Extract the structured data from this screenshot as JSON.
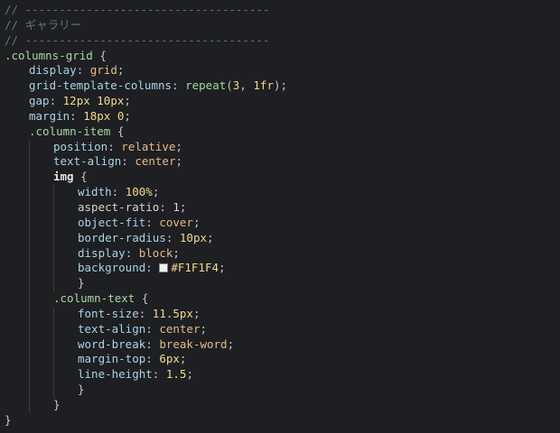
{
  "editor": {
    "colors": {
      "background": "#1e1f22",
      "comment": "#6b7079",
      "selector": "#a8d8a0",
      "property": "#a9d3e8",
      "value": "#e6b98a",
      "number": "#f2d98f",
      "swatch": "#F1F1F4"
    },
    "lines": [
      {
        "segments": [
          {
            "text": "// ------------------------------------",
            "kind": "comment"
          }
        ],
        "indent": 0
      },
      {
        "segments": [
          {
            "text": "// ギャラリー",
            "kind": "comment"
          }
        ],
        "indent": 0
      },
      {
        "segments": [
          {
            "text": "// ------------------------------------",
            "kind": "comment"
          }
        ],
        "indent": 0
      },
      {
        "segments": [
          {
            "text": ".columns-grid",
            "kind": "sel"
          },
          {
            "text": " {",
            "kind": "punc"
          }
        ],
        "indent": 0
      },
      {
        "segments": [
          {
            "text": "display",
            "kind": "prop"
          },
          {
            "text": ": ",
            "kind": "punc"
          },
          {
            "text": "grid",
            "kind": "val"
          },
          {
            "text": ";",
            "kind": "punc"
          }
        ],
        "indent": 1
      },
      {
        "segments": [
          {
            "text": "grid-template-columns",
            "kind": "prop"
          },
          {
            "text": ": ",
            "kind": "punc"
          },
          {
            "text": "repeat(",
            "kind": "sel"
          },
          {
            "text": "3",
            "kind": "num"
          },
          {
            "text": ", ",
            "kind": "punc"
          },
          {
            "text": "1fr",
            "kind": "num"
          },
          {
            "text": ");",
            "kind": "punc"
          }
        ],
        "indent": 1
      },
      {
        "segments": [
          {
            "text": "gap",
            "kind": "prop"
          },
          {
            "text": ": ",
            "kind": "punc"
          },
          {
            "text": "12px 10px",
            "kind": "num"
          },
          {
            "text": ";",
            "kind": "punc"
          }
        ],
        "indent": 1
      },
      {
        "segments": [
          {
            "text": "margin",
            "kind": "prop"
          },
          {
            "text": ": ",
            "kind": "punc"
          },
          {
            "text": "18px 0",
            "kind": "num"
          },
          {
            "text": ";",
            "kind": "punc"
          }
        ],
        "indent": 1
      },
      {
        "segments": [
          {
            "text": ".column-item",
            "kind": "sel"
          },
          {
            "text": " {",
            "kind": "punc"
          }
        ],
        "indent": 1
      },
      {
        "segments": [
          {
            "text": "position",
            "kind": "prop"
          },
          {
            "text": ": ",
            "kind": "punc"
          },
          {
            "text": "relative",
            "kind": "val"
          },
          {
            "text": ";",
            "kind": "punc"
          }
        ],
        "indent": 2
      },
      {
        "segments": [
          {
            "text": "text-align",
            "kind": "prop"
          },
          {
            "text": ": ",
            "kind": "punc"
          },
          {
            "text": "center",
            "kind": "val"
          },
          {
            "text": ";",
            "kind": "punc"
          }
        ],
        "indent": 2
      },
      {
        "segments": [
          {
            "text": "img",
            "kind": "tag"
          },
          {
            "text": " {",
            "kind": "punc"
          }
        ],
        "indent": 2
      },
      {
        "segments": [
          {
            "text": "width",
            "kind": "prop"
          },
          {
            "text": ": ",
            "kind": "punc"
          },
          {
            "text": "100%",
            "kind": "num"
          },
          {
            "text": ";",
            "kind": "punc"
          }
        ],
        "indent": 3
      },
      {
        "segments": [
          {
            "text": "aspect-ratio",
            "kind": "text"
          },
          {
            "text": ": ",
            "kind": "punc"
          },
          {
            "text": "1",
            "kind": "text"
          },
          {
            "text": ";",
            "kind": "punc"
          }
        ],
        "indent": 3
      },
      {
        "segments": [
          {
            "text": "object-fit",
            "kind": "prop"
          },
          {
            "text": ": ",
            "kind": "punc"
          },
          {
            "text": "cover",
            "kind": "val"
          },
          {
            "text": ";",
            "kind": "punc"
          }
        ],
        "indent": 3
      },
      {
        "segments": [
          {
            "text": "border-radius",
            "kind": "prop"
          },
          {
            "text": ": ",
            "kind": "punc"
          },
          {
            "text": "10px",
            "kind": "num"
          },
          {
            "text": ";",
            "kind": "punc"
          }
        ],
        "indent": 3
      },
      {
        "segments": [
          {
            "text": "display",
            "kind": "prop"
          },
          {
            "text": ": ",
            "kind": "punc"
          },
          {
            "text": "block",
            "kind": "val"
          },
          {
            "text": ";",
            "kind": "punc"
          }
        ],
        "indent": 3
      },
      {
        "segments": [
          {
            "text": "background",
            "kind": "prop"
          },
          {
            "text": ": ",
            "kind": "punc"
          },
          {
            "text": "",
            "kind": "swatch"
          },
          {
            "text": "#F1F1F4",
            "kind": "num"
          },
          {
            "text": ";",
            "kind": "punc"
          }
        ],
        "indent": 3
      },
      {
        "segments": [
          {
            "text": "}",
            "kind": "punc"
          }
        ],
        "indent": 3
      },
      {
        "segments": [
          {
            "text": ".column-text",
            "kind": "sel"
          },
          {
            "text": " {",
            "kind": "punc"
          }
        ],
        "indent": 2
      },
      {
        "segments": [
          {
            "text": "font-size",
            "kind": "prop"
          },
          {
            "text": ": ",
            "kind": "punc"
          },
          {
            "text": "11.5px",
            "kind": "num"
          },
          {
            "text": ";",
            "kind": "punc"
          }
        ],
        "indent": 3
      },
      {
        "segments": [
          {
            "text": "text-align",
            "kind": "prop"
          },
          {
            "text": ": ",
            "kind": "punc"
          },
          {
            "text": "center",
            "kind": "val"
          },
          {
            "text": ";",
            "kind": "punc"
          }
        ],
        "indent": 3
      },
      {
        "segments": [
          {
            "text": "word-break",
            "kind": "prop"
          },
          {
            "text": ": ",
            "kind": "punc"
          },
          {
            "text": "break-word",
            "kind": "val"
          },
          {
            "text": ";",
            "kind": "punc"
          }
        ],
        "indent": 3
      },
      {
        "segments": [
          {
            "text": "margin-top",
            "kind": "prop"
          },
          {
            "text": ": ",
            "kind": "punc"
          },
          {
            "text": "6px",
            "kind": "num"
          },
          {
            "text": ";",
            "kind": "punc"
          }
        ],
        "indent": 3
      },
      {
        "segments": [
          {
            "text": "line-height",
            "kind": "prop"
          },
          {
            "text": ": ",
            "kind": "punc"
          },
          {
            "text": "1.5",
            "kind": "num"
          },
          {
            "text": ";",
            "kind": "punc"
          }
        ],
        "indent": 3
      },
      {
        "segments": [
          {
            "text": "}",
            "kind": "punc"
          }
        ],
        "indent": 3
      },
      {
        "segments": [
          {
            "text": "}",
            "kind": "punc"
          }
        ],
        "indent": 2
      },
      {
        "segments": [
          {
            "text": "}",
            "kind": "punc"
          }
        ],
        "indent": 0
      }
    ]
  }
}
